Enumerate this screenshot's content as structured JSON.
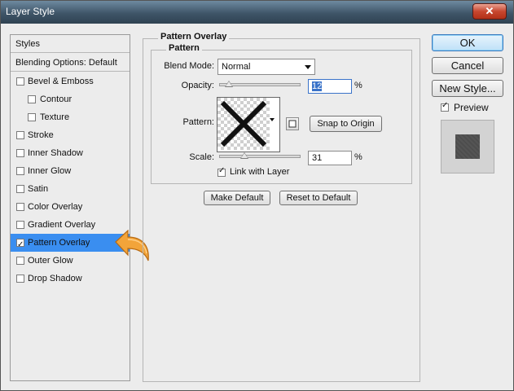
{
  "window": {
    "title": "Layer Style",
    "close_glyph": "✕"
  },
  "styles_panel": {
    "header": "Styles",
    "blending_options": "Blending Options: Default",
    "items": [
      {
        "label": "Bevel & Emboss",
        "checked": false,
        "indent": false
      },
      {
        "label": "Contour",
        "checked": false,
        "indent": true
      },
      {
        "label": "Texture",
        "checked": false,
        "indent": true
      },
      {
        "label": "Stroke",
        "checked": false,
        "indent": false
      },
      {
        "label": "Inner Shadow",
        "checked": false,
        "indent": false
      },
      {
        "label": "Inner Glow",
        "checked": false,
        "indent": false
      },
      {
        "label": "Satin",
        "checked": false,
        "indent": false
      },
      {
        "label": "Color Overlay",
        "checked": false,
        "indent": false
      },
      {
        "label": "Gradient Overlay",
        "checked": false,
        "indent": false
      },
      {
        "label": "Pattern Overlay",
        "checked": true,
        "indent": false,
        "selected": true
      },
      {
        "label": "Outer Glow",
        "checked": false,
        "indent": false
      },
      {
        "label": "Drop Shadow",
        "checked": false,
        "indent": false
      }
    ]
  },
  "pattern_overlay": {
    "group_title": "Pattern Overlay",
    "subgroup_title": "Pattern",
    "blend_mode_label": "Blend Mode:",
    "blend_mode_value": "Normal",
    "opacity_label": "Opacity:",
    "opacity_value": "12",
    "opacity_unit": "%",
    "opacity_level": 0.12,
    "pattern_label": "Pattern:",
    "snap_button": "Snap to Origin",
    "scale_label": "Scale:",
    "scale_value": "31",
    "scale_unit": "%",
    "scale_level": 0.31,
    "link_label": "Link with Layer",
    "link_checked": true,
    "make_default": "Make Default",
    "reset_default": "Reset to Default"
  },
  "actions": {
    "ok": "OK",
    "cancel": "Cancel",
    "new_style": "New Style...",
    "preview_label": "Preview",
    "preview_checked": true
  },
  "colors": {
    "selection": "#3a8ef0",
    "arrow": "#f2a43a",
    "title_bar": "#3f5568"
  },
  "icons": [
    "close-icon",
    "checkbox-icon",
    "dropdown-caret-icon",
    "pattern-options-icon",
    "curved-arrow-icon"
  ]
}
